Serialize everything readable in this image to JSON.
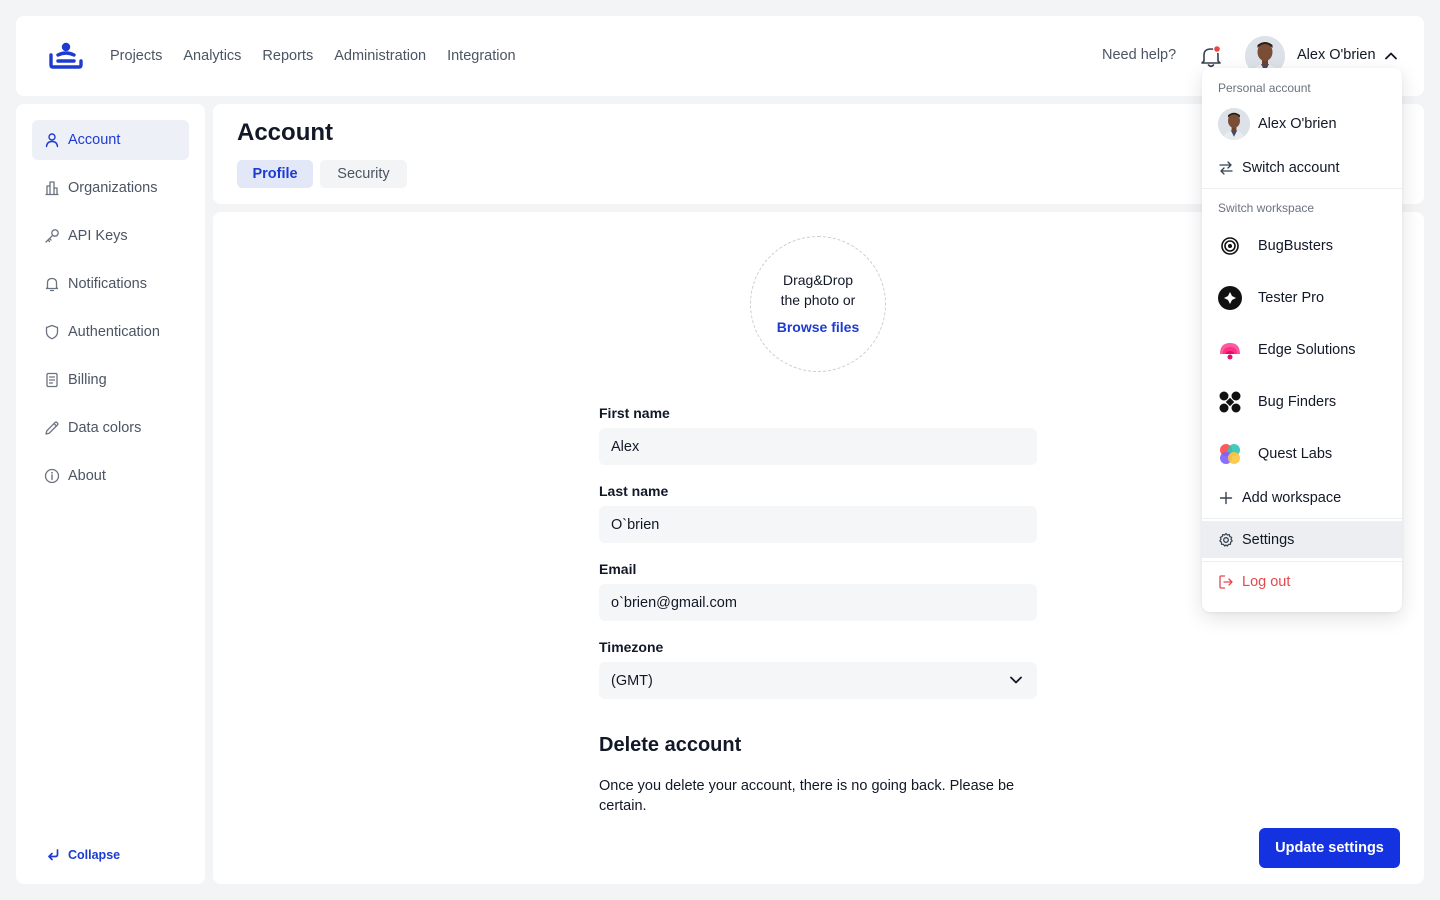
{
  "nav": {
    "items": [
      {
        "label": "Projects"
      },
      {
        "label": "Analytics"
      },
      {
        "label": "Reports"
      },
      {
        "label": "Administration"
      },
      {
        "label": "Integration"
      }
    ],
    "help_label": "Need help?",
    "user_name": "Alex O'brien",
    "notification_dot_color": "#ef4444"
  },
  "sidebar": {
    "items": [
      {
        "label": "Account",
        "icon": "user-icon",
        "active": true
      },
      {
        "label": "Organizations",
        "icon": "building-icon"
      },
      {
        "label": "API Keys",
        "icon": "key-icon"
      },
      {
        "label": "Notifications",
        "icon": "bell-icon"
      },
      {
        "label": "Authentication",
        "icon": "shield-icon"
      },
      {
        "label": "Billing",
        "icon": "receipt-icon"
      },
      {
        "label": "Data colors",
        "icon": "pen-icon"
      },
      {
        "label": "About",
        "icon": "info-icon"
      }
    ],
    "collapse_label": "Collapse"
  },
  "header": {
    "title": "Account",
    "tabs": [
      {
        "label": "Profile",
        "active": true
      },
      {
        "label": "Security"
      }
    ]
  },
  "profile": {
    "upload_line1": "Drag&Drop",
    "upload_line2": "the photo or",
    "upload_link": "Browse files",
    "first_name_label": "First name",
    "first_name_value": "Alex",
    "last_name_label": "Last name",
    "last_name_value": "O`brien",
    "email_label": "Email",
    "email_value": "o`brien@gmail.com",
    "timezone_label": "Timezone",
    "timezone_value": "(GMT)",
    "delete_title": "Delete account",
    "delete_text": "Once you delete your account, there is no going back. Please be certain.",
    "update_button": "Update settings"
  },
  "dropdown": {
    "personal_section": "Personal account",
    "personal_name": "Alex O'brien",
    "switch_account": "Switch account",
    "workspace_section": "Switch workspace",
    "workspaces": [
      {
        "label": "BugBusters",
        "icon": "bugbusters-logo-icon"
      },
      {
        "label": "Tester Pro",
        "icon": "tester-pro-logo-icon"
      },
      {
        "label": "Edge Solutions",
        "icon": "edge-solutions-logo-icon"
      },
      {
        "label": "Bug Finders",
        "icon": "bug-finders-logo-icon"
      },
      {
        "label": "Quest Labs",
        "icon": "quest-labs-logo-icon"
      }
    ],
    "add_workspace": "Add workspace",
    "settings": "Settings",
    "logout": "Log out"
  },
  "colors": {
    "accent": "#1d3bd1",
    "button": "#1432e0",
    "danger": "#e5484d"
  }
}
